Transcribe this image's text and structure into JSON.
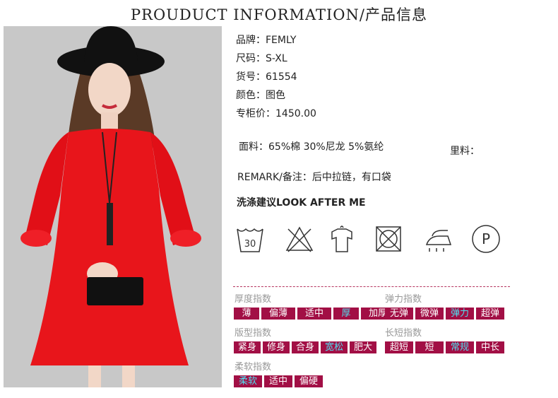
{
  "header": {
    "title": "PROUDUCT INFORMATION/产品信息"
  },
  "photo": {
    "alt": "product-photo"
  },
  "specs": {
    "brand": "品牌：FEMLY",
    "size": "尺码：S-XL",
    "item_no": "货号：61554",
    "color": "颜色：图色",
    "price": "专柜价：1450.00",
    "fabric": "面料：65%棉 30%尼龙 5%氨纶",
    "lining": "里料：",
    "remark": "REMARK/备注：后中拉链，有口袋"
  },
  "care": {
    "title": "洗涤建议LOOK AFTER ME",
    "wash_temp": "30",
    "icons": [
      "wash-30-icon",
      "no-bleach-icon",
      "hang-dry-icon",
      "no-tumble-dry-icon",
      "iron-icon",
      "dry-clean-p-icon"
    ],
    "dry_clean_letter": "P"
  },
  "indices": {
    "thickness": {
      "label": "厚度指数",
      "options": [
        "薄",
        "偏薄",
        "适中",
        "厚",
        "加厚"
      ],
      "selected": "厚"
    },
    "elasticity": {
      "label": "弹力指数",
      "options": [
        "无弹",
        "微弹",
        "弹力",
        "超弹"
      ],
      "selected": "弹力"
    },
    "fit": {
      "label": "版型指数",
      "options": [
        "紧身",
        "修身",
        "合身",
        "宽松",
        "肥大"
      ],
      "selected": "宽松"
    },
    "length": {
      "label": "长短指数",
      "options": [
        "超短",
        "短",
        "常规",
        "中长"
      ],
      "selected": "常规"
    },
    "softness": {
      "label": "柔软指数",
      "options": [
        "柔软",
        "适中",
        "偏硬"
      ],
      "selected": "柔软"
    }
  },
  "colors": {
    "accent": "#a20f45",
    "selected_text": "#4fe0f0",
    "dress": "#e8151b",
    "background": "#c9c9c9"
  }
}
